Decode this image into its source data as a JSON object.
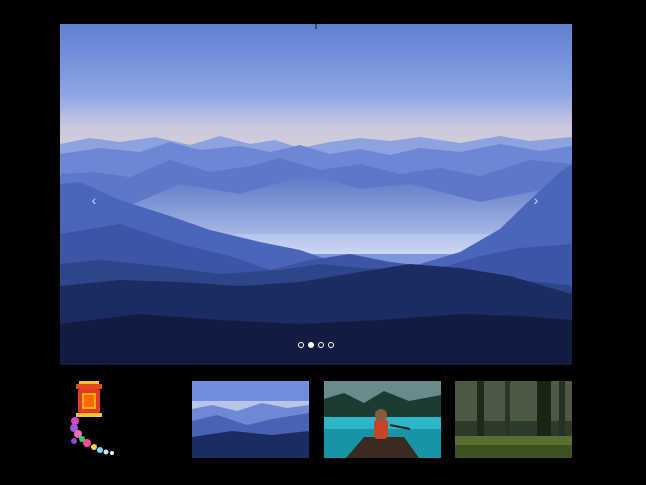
{
  "carousel": {
    "main_image": "blue-misty-mountains",
    "prev_icon": "chevron-left-icon",
    "next_icon": "chevron-right-icon",
    "prev_glyph": "‹",
    "next_glyph": "›",
    "slide_count": 4,
    "active_slide": 2
  },
  "thumbnails": [
    {
      "image": "blue-misty-mountains"
    },
    {
      "image": "woman-in-canoe-on-turquoise-lake"
    },
    {
      "image": "green-forest"
    }
  ],
  "decoration": {
    "image": "colorful-lantern-character"
  },
  "colors": {
    "background": "#000000",
    "sky": "#6f8fd8",
    "dot": "#ffffff"
  }
}
